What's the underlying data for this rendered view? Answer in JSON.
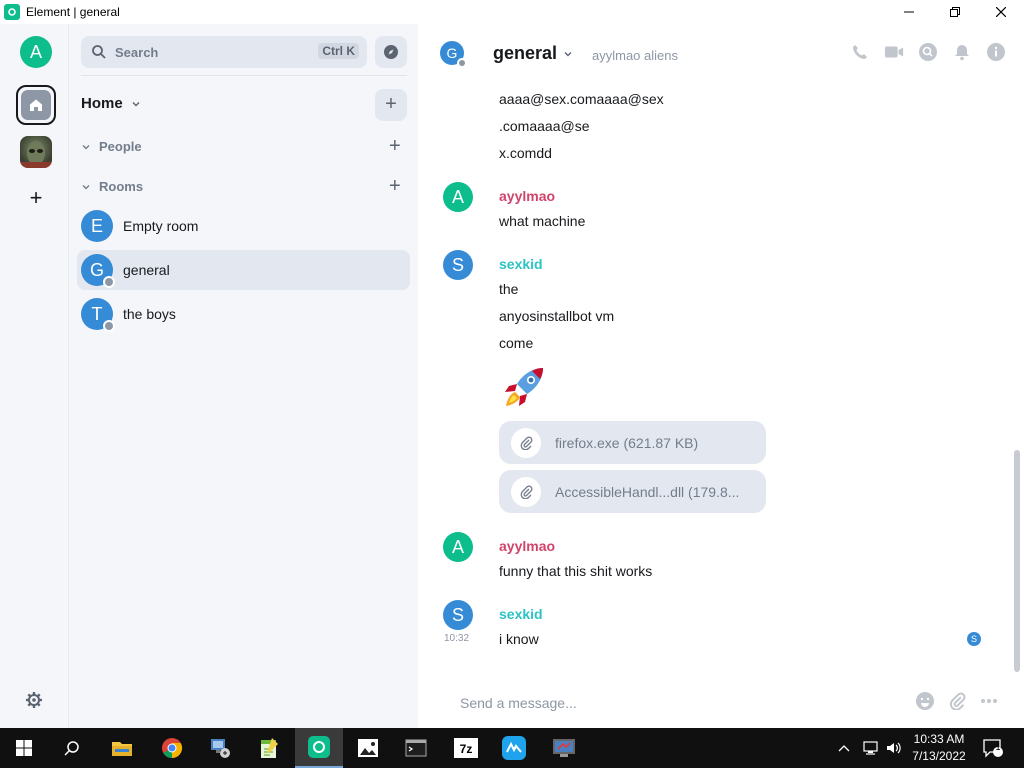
{
  "window": {
    "title": "Element | general"
  },
  "spaces": {
    "user_initial": "A",
    "add_label": "+"
  },
  "room_list": {
    "search_placeholder": "Search",
    "search_shortcut": "Ctrl K",
    "home_label": "Home",
    "sections": {
      "people": "People",
      "rooms": "Rooms"
    },
    "rooms": [
      {
        "initial": "E",
        "name": "Empty room"
      },
      {
        "initial": "G",
        "name": "general"
      },
      {
        "initial": "T",
        "name": "the boys"
      }
    ]
  },
  "header": {
    "initial": "G",
    "room_name": "general",
    "topic": "ayylmao aliens"
  },
  "timeline": {
    "top_lines": [
      "aaaa@sex.comaaaa@sex",
      ".comaaaa@se",
      "x.comdd"
    ],
    "messages": [
      {
        "sender": "ayylmao",
        "initial": "A",
        "lines": [
          "what machine"
        ]
      },
      {
        "sender": "sexkid",
        "initial": "S",
        "lines": [
          "the",
          "anyosinstallbot vm",
          "come"
        ],
        "emoji": "🚀"
      },
      {
        "sender": "ayylmao",
        "initial": "A",
        "lines": [
          "funny that this shit works"
        ]
      },
      {
        "sender": "sexkid",
        "initial": "S",
        "lines": [
          "i know"
        ],
        "timestamp": "10:32"
      }
    ],
    "files": [
      {
        "name": "firefox.exe (621.87 KB)"
      },
      {
        "name": "AccessibleHandl...dll (179.8..."
      }
    ],
    "read_receipt_initial": "S"
  },
  "composer": {
    "placeholder": "Send a message..."
  },
  "taskbar": {
    "time": "10:33 AM",
    "date": "7/13/2022",
    "notification_count": "1"
  },
  "colors": {
    "accent": "#0dbd8b",
    "avatar_blue": "#368bd6",
    "ayylmao": "#d0436b",
    "sexkid": "#2dc2c5"
  }
}
